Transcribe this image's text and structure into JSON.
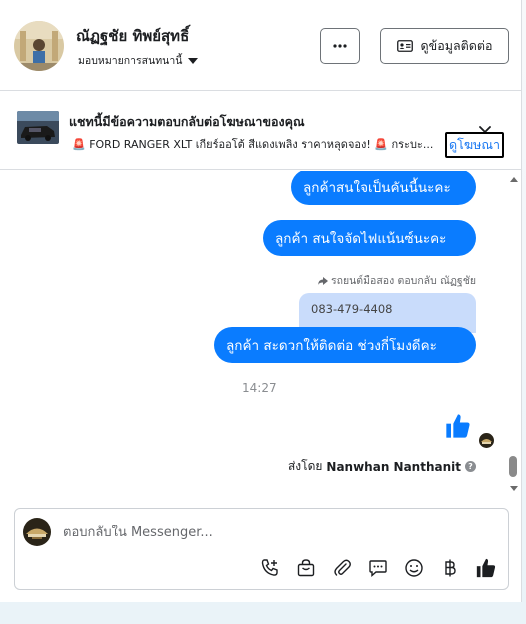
{
  "header": {
    "name": "ณัฏฐชัย ทิพย์สุทธิ์",
    "assignment": "มอบหมายการสนทนานี้",
    "more_icon": "more-horizontal-icon",
    "contact_button": "ดูข้อมูลติดต่อ",
    "contact_icon": "id-card-icon"
  },
  "ad_banner": {
    "title": "แชทนี้มีข้อความตอบกลับต่อโฆษณาของคุณ",
    "text": "🚨 FORD RANGER XLT เกียร์ออโต้ สีแดงเพลิง ราคาหลุดจอง! 🚨 กระบะ...",
    "view_ad": "ดูโฆษณา",
    "close_icon": "close-icon"
  },
  "messages": [
    {
      "type": "outgoing",
      "text": "ลูกค้าสนใจเป็นคันนี้นะคะ"
    },
    {
      "type": "outgoing",
      "text": "ลูกค้า สนใจจัดไฟแน้นซ์นะคะ"
    },
    {
      "type": "reply_meta",
      "text": "รถยนต์มือสอง ตอบกลับ ณัฏฐชัย"
    },
    {
      "type": "quoted",
      "text": "083-479-4408"
    },
    {
      "type": "outgoing",
      "text": "ลูกค้า  สะดวกให้ติดต่อ ช่วงกี่โมงดีคะ"
    }
  ],
  "timestamp": "14:27",
  "sent_by": {
    "prefix": "ส่งโดย",
    "name": "Nanwhan Nanthanit"
  },
  "composer": {
    "placeholder": "ตอบกลับใน Messenger...",
    "tools": [
      "phone-add-icon",
      "shopping-bag-icon",
      "attachment-icon",
      "chat-bubble-icon",
      "emoji-icon",
      "baht-icon",
      "like-icon"
    ]
  },
  "colors": {
    "accent": "#0a7cff",
    "link": "#1877f2",
    "quoted_bg": "#c9dcfb"
  }
}
